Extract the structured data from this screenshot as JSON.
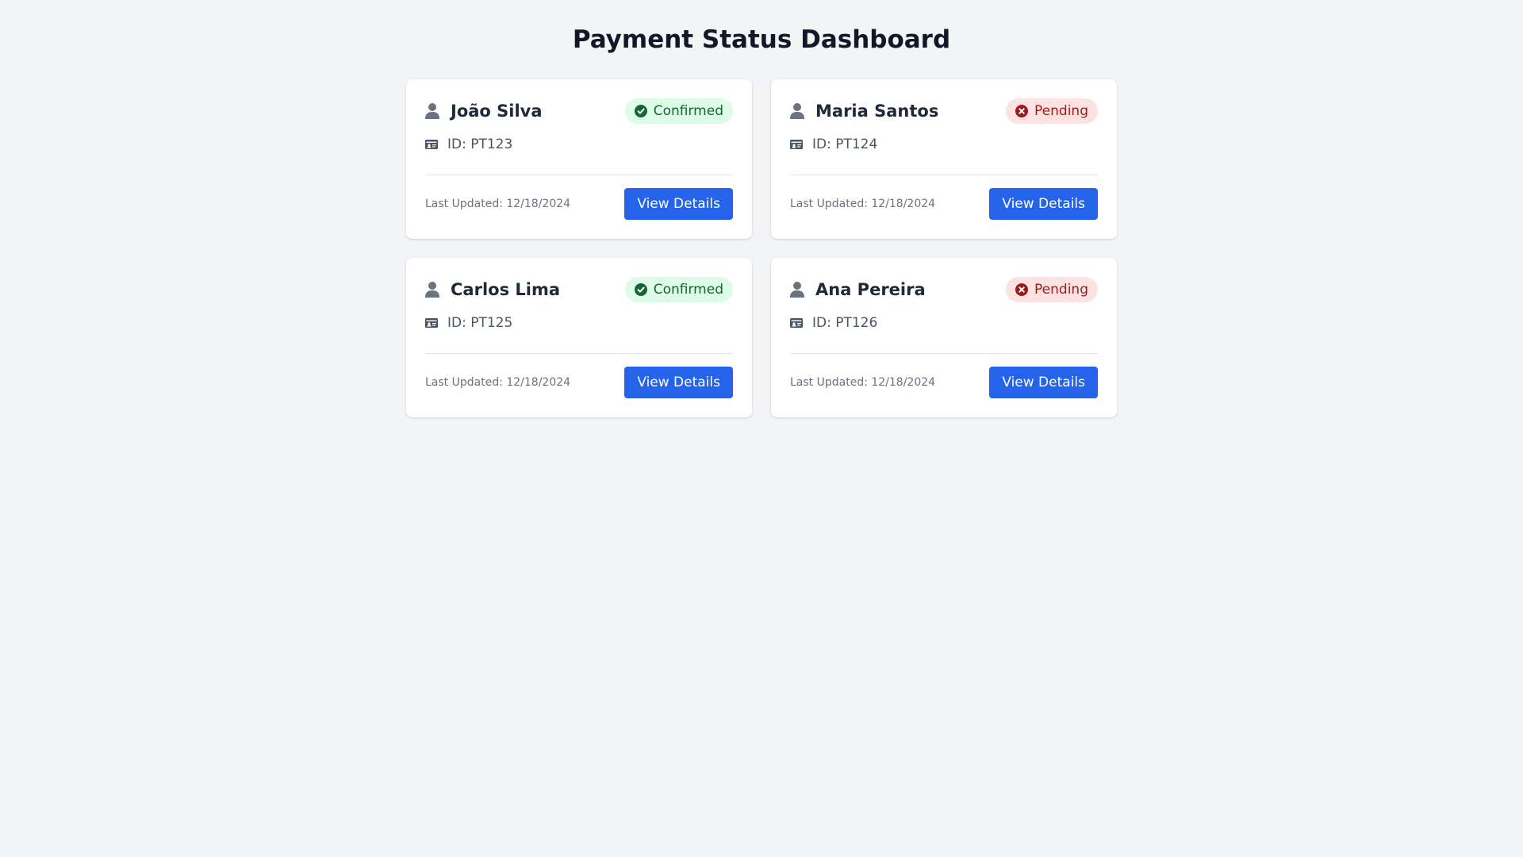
{
  "page_title": "Payment Status Dashboard",
  "colors": {
    "background": "#f3f4f6",
    "card": "#ffffff",
    "primary_button": "#2563eb",
    "confirmed_bg": "#dcfce7",
    "confirmed_text": "#166534",
    "pending_bg": "#fee2e2",
    "pending_text": "#991b1b"
  },
  "cards": [
    {
      "name": "João Silva",
      "status": "Confirmed",
      "status_icon": "check-circle-icon",
      "id_text": "ID: PT123",
      "updated": "Last Updated: 12/18/2024",
      "button_label": "View Details"
    },
    {
      "name": "Maria Santos",
      "status": "Pending",
      "status_icon": "x-circle-icon",
      "id_text": "ID: PT124",
      "updated": "Last Updated: 12/18/2024",
      "button_label": "View Details"
    },
    {
      "name": "Carlos Lima",
      "status": "Confirmed",
      "status_icon": "check-circle-icon",
      "id_text": "ID: PT125",
      "updated": "Last Updated: 12/18/2024",
      "button_label": "View Details"
    },
    {
      "name": "Ana Pereira",
      "status": "Pending",
      "status_icon": "x-circle-icon",
      "id_text": "ID: PT126",
      "updated": "Last Updated: 12/18/2024",
      "button_label": "View Details"
    }
  ]
}
